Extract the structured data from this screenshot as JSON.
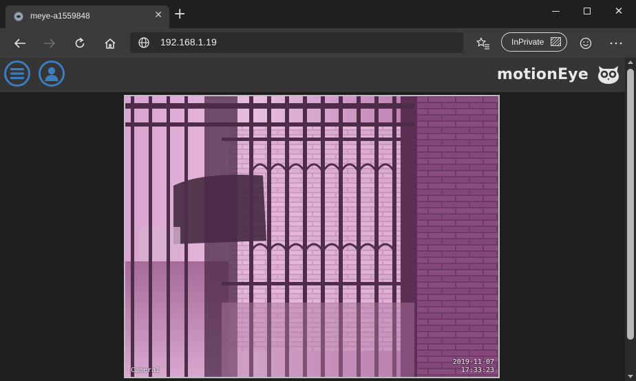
{
  "browser": {
    "tab_title": "meye-a1559848",
    "address": "192.168.1.19",
    "inprivate_label": "InPrivate"
  },
  "app": {
    "logo_text": "motionEye"
  },
  "camera": {
    "name": "Camera1",
    "date": "2019-11-07",
    "time": "17:33:23"
  },
  "colors": {
    "accent": "#3b7dbf",
    "header_bg": "#353535",
    "page_bg": "#1e1e1e",
    "feed_tint": "#7c3f72"
  }
}
